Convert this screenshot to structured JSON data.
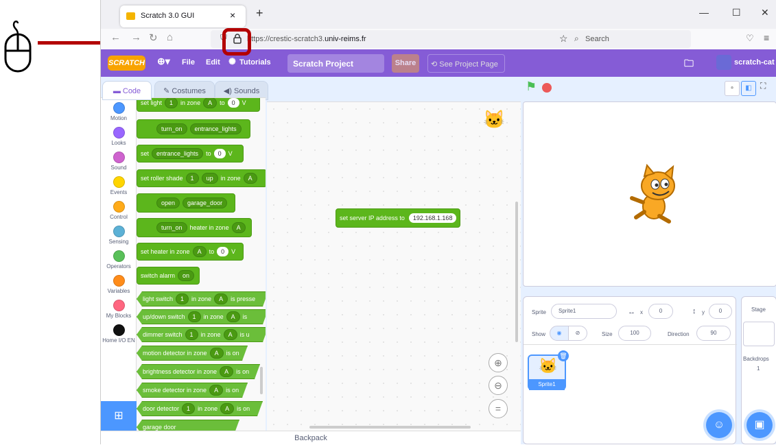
{
  "browser": {
    "tab_title": "Scratch 3.0 GUI",
    "tab_close": "×",
    "new_tab": "+",
    "url_prefix": "https://crestic-scratch3.",
    "url_domain": "univ-reims.fr",
    "search_placeholder": "Search",
    "window_minimize": "—",
    "window_maximize": "☐",
    "window_close": "✕"
  },
  "menu": {
    "logo": "SCRATCH",
    "file": "File",
    "edit": "Edit",
    "tutorials": "Tutorials",
    "project_title": "Scratch Project",
    "share": "Share",
    "see_project_page": "See Project Page",
    "username": "scratch-cat"
  },
  "editor_tabs": {
    "code": "Code",
    "costumes": "Costumes",
    "sounds": "Sounds"
  },
  "categories": [
    {
      "label": "Motion",
      "color": "#4c97ff"
    },
    {
      "label": "Looks",
      "color": "#9966ff"
    },
    {
      "label": "Sound",
      "color": "#cf63cf"
    },
    {
      "label": "Events",
      "color": "#ffd500"
    },
    {
      "label": "Control",
      "color": "#ffab19"
    },
    {
      "label": "Sensing",
      "color": "#5cb1d6"
    },
    {
      "label": "Operators",
      "color": "#59c059"
    },
    {
      "label": "Variables",
      "color": "#ff8c1a"
    },
    {
      "label": "My Blocks",
      "color": "#ff6680"
    },
    {
      "label": "Home I/O EN",
      "color": "#111111"
    }
  ],
  "blocks": {
    "set_light": "set light",
    "one": "1",
    "in_zone": "in zone",
    "zone_a": "A",
    "to": "to",
    "zero": "0",
    "v": "V",
    "turn_on": "turn_on",
    "entrance_lights": "entrance_lights",
    "set": "set",
    "set_roller_shade": "set roller shade",
    "up": "up",
    "open": "open",
    "garage_door": "garage_door",
    "heater_in_zone": "heater in zone",
    "set_heater_in_zone": "set heater in zone",
    "switch_alarm": "switch alarm",
    "on": "on",
    "light_switch": "light switch",
    "is_pressed": "is presse",
    "updown_switch": "up/down switch",
    "is": "is",
    "dimmer_switch": "dimmer switch",
    "is_u": "is u",
    "motion_detector": "motion detector in zone",
    "is_on": "is on",
    "brightness_detector": "brightness detector in zone",
    "smoke_detector": "smoke detector in zone",
    "door_detector": "door detector",
    "extra": "garage door"
  },
  "script": {
    "set_server_ip": "set server IP address to",
    "ip_value": "192.168.1.168"
  },
  "backpack": "Backpack",
  "sprite": {
    "sprite_label": "Sprite",
    "sprite_name": "Sprite1",
    "x_label": "x",
    "x_value": "0",
    "y_label": "y",
    "y_value": "0",
    "show_label": "Show",
    "size_label": "Size",
    "size_value": "100",
    "direction_label": "Direction",
    "direction_value": "90",
    "thumb_name": "Sprite1"
  },
  "stage_panel": {
    "title": "Stage",
    "backdrops_label": "Backdrops",
    "backdrops_count": "1"
  }
}
